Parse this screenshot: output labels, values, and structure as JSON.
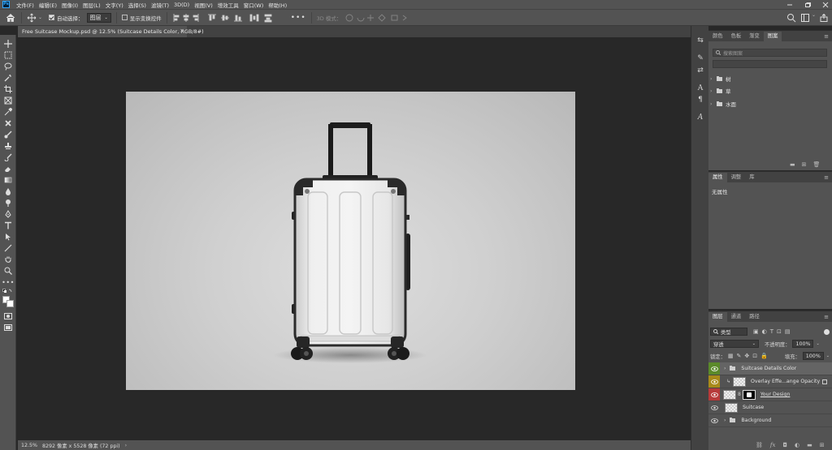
{
  "menubar": {
    "items": [
      "文件(F)",
      "编辑(E)",
      "图像(I)",
      "图层(L)",
      "文字(Y)",
      "选择(S)",
      "滤镜(T)",
      "3D(D)",
      "视图(V)",
      "增效工具",
      "窗口(W)",
      "帮助(H)"
    ]
  },
  "optionsbar": {
    "auto_select_label": "自动选择：",
    "auto_select_value": "图层",
    "show_transform_label": "显示变换控件",
    "mode3d_label": "3D 模式："
  },
  "document": {
    "tab_title": "Free Suitcase Mockup.psd @ 12.5% (Suitcase Details Color, RGB/8#)",
    "zoom": "12.5%",
    "dimensions": "8292 像素 x 5528 像素 (72 ppi)"
  },
  "panels": {
    "top_tabs": [
      "颜色",
      "色板",
      "渐变",
      "图案"
    ],
    "search_placeholder": "搜索图案",
    "pattern_groups": [
      "树",
      "草",
      "水面"
    ],
    "props_tabs": [
      "属性",
      "调整",
      "库"
    ],
    "props_empty": "无属性",
    "layers_tabs": [
      "图层",
      "通道",
      "路径"
    ]
  },
  "layers_panel": {
    "filter_kind": "类型",
    "blend_mode": "穿透",
    "opacity_label": "不透明度：",
    "opacity_value": "100%",
    "lock_label": "锁定：",
    "fill_label": "填充：",
    "fill_value": "100%",
    "layers": [
      {
        "name": "Suitcase Details Color",
        "type": "group",
        "eye_color": "#5b8a2a",
        "selected": true
      },
      {
        "name": "Overlay Effe...ange Opacity",
        "type": "pixel",
        "eye_color": "#a88a1a",
        "selected": false
      },
      {
        "name": "Your Design",
        "type": "smart-mask",
        "eye_color": "#b83a3a",
        "selected": false
      },
      {
        "name": "Suitcase",
        "type": "pixel",
        "eye_color": "#535353",
        "selected": false
      },
      {
        "name": "Background",
        "type": "group",
        "eye_color": "#535353",
        "selected": false
      }
    ]
  },
  "colors": {
    "ui_bg": "#535353",
    "workspace": "#282828",
    "selected_layer": "#646464",
    "accent": "#31a8ff"
  }
}
